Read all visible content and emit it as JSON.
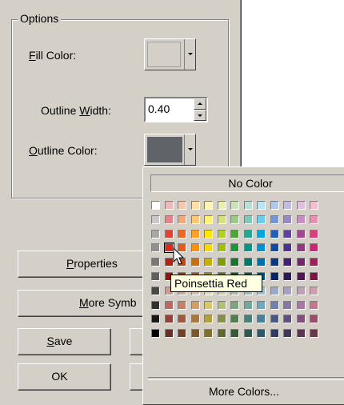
{
  "options_group": {
    "legend": "Options"
  },
  "fill_color": {
    "label_underlined": "F",
    "label_rest": "ill Color:",
    "swatch_color": "#d4d0c8"
  },
  "outline_width": {
    "label_prefix": "Outline ",
    "label_underlined": "W",
    "label_rest": "idth:",
    "value": "0.40"
  },
  "outline_color": {
    "label_underlined": "O",
    "label_rest": "utline Color:",
    "swatch_color": "#606468"
  },
  "buttons": {
    "properties_underlined": "P",
    "properties_rest": "roperties",
    "more_symbols_underlined": "M",
    "more_symbols_rest": "ore Symb",
    "save_underlined": "S",
    "save_rest": "ave",
    "ok": "OK"
  },
  "palette": {
    "no_color": "No Color",
    "more_colors": "More Colors...",
    "rows": [
      [
        "#ffffff",
        "#f4b6b8",
        "#f7c8a8",
        "#fde0a8",
        "#fff4b0",
        "#e8f0b0",
        "#c8e4b8",
        "#b8e0d8",
        "#b8e4f4",
        "#b0c8ec",
        "#c4bce0",
        "#e0c0dc",
        "#f0c0d0"
      ],
      [
        "#c8c8c8",
        "#ec8088",
        "#f4a878",
        "#fcc878",
        "#fff070",
        "#d8e078",
        "#98cc88",
        "#80c8b8",
        "#70ccec",
        "#7098d8",
        "#9888c8",
        "#c890c0",
        "#e890b0"
      ],
      [
        "#a8a8a8",
        "#e84030",
        "#f06820",
        "#fca028",
        "#ffe800",
        "#b4d020",
        "#48a830",
        "#20a890",
        "#00a8e0",
        "#2060c0",
        "#6040a0",
        "#a04890",
        "#d84080"
      ],
      [
        "#909090",
        "#e02818",
        "#e85818",
        "#f89010",
        "#f8d800",
        "#a0c000",
        "#209830",
        "#009880",
        "#0090d0",
        "#1048a8",
        "#503090",
        "#903880",
        "#c82870"
      ],
      [
        "#787878",
        "#b82010",
        "#c04810",
        "#c87010",
        "#c8b000",
        "#80a000",
        "#187828",
        "#007868",
        "#0070a8",
        "#083888",
        "#402078",
        "#702868",
        "#a02058"
      ],
      [
        "#606060",
        "#901808",
        "#983808",
        "#a05808",
        "#a08800",
        "#607800",
        "#105820",
        "#005850",
        "#005080",
        "#062868",
        "#301858",
        "#501850",
        "#781840"
      ],
      [
        "#484848",
        "#d09890",
        "#d0a890",
        "#d8c098",
        "#e0d8a0",
        "#c8d098",
        "#a0c0a0",
        "#98c0b8",
        "#98c0d0",
        "#98a8c8",
        "#a8a0c0",
        "#c0a0b8",
        "#d0a0b0"
      ],
      [
        "#303030",
        "#c06860",
        "#c88060",
        "#d0a068",
        "#d8c868",
        "#b0c070",
        "#78a878",
        "#70a8a0",
        "#70a8c0",
        "#7080b0",
        "#8878a8",
        "#a878a0",
        "#c07890"
      ],
      [
        "#181818",
        "#984038",
        "#a05838",
        "#a87840",
        "#b0a040",
        "#889048",
        "#508050",
        "#488078",
        "#488098",
        "#485888",
        "#605080",
        "#805078",
        "#985068"
      ],
      [
        "#000000",
        "#683028",
        "#704028",
        "#785830",
        "#807030",
        "#606830",
        "#385838",
        "#305850",
        "#305868",
        "#303c60",
        "#403858",
        "#583850",
        "#683848"
      ]
    ],
    "hover_cell": {
      "row": 3,
      "col": 1
    },
    "tooltip": "Poinsettia Red"
  }
}
